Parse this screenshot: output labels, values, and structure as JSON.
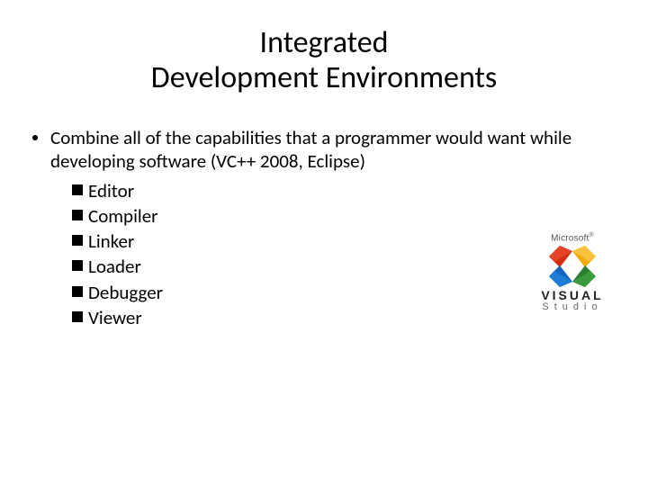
{
  "title_line1": "Integrated",
  "title_line2": "Development Environments",
  "bullet": {
    "text": "Combine all of the capabilities that a programmer would want while developing software (VC++ 2008, Eclipse)",
    "subitems": [
      "Editor",
      "Compiler",
      "Linker",
      "Loader",
      "Debugger",
      "Viewer"
    ]
  },
  "logo": {
    "brand": "Microsoft",
    "line1": "VISUAL",
    "line2": "Studio"
  }
}
